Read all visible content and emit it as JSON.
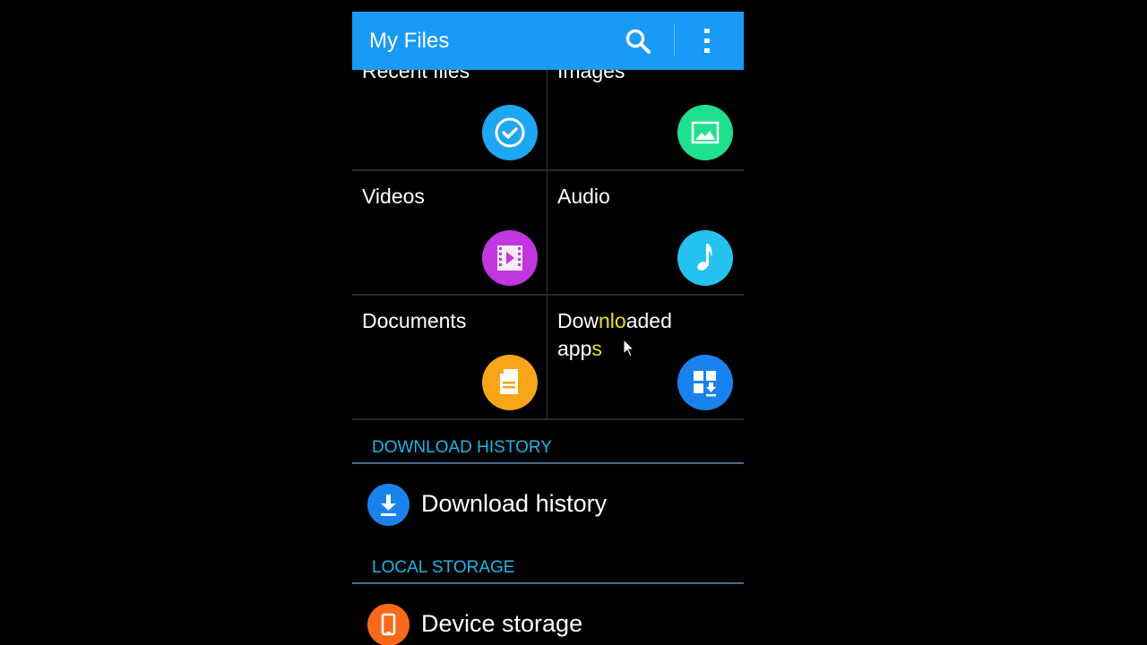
{
  "app": {
    "title": "My Files",
    "actions": {
      "search_icon": "search-icon",
      "more_icon": "more-vert-icon"
    },
    "accent_color": "#1a9af7"
  },
  "categories": [
    {
      "label": "Recent files",
      "icon": "clock-check-icon",
      "color": "#1ea7f2"
    },
    {
      "label": "Images",
      "icon": "image-icon",
      "color": "#1fe08e"
    },
    {
      "label": "Videos",
      "icon": "film-play-icon",
      "color": "#c236e0"
    },
    {
      "label": "Audio",
      "icon": "music-note-icon",
      "color": "#25c2f0"
    },
    {
      "label": "Documents",
      "icon": "document-icon",
      "color": "#f8a51a"
    },
    {
      "label_parts": [
        "Dow",
        "nlo",
        "aded",
        "app",
        "s"
      ],
      "label": "Downloaded apps",
      "icon": "apps-download-icon",
      "color": "#1a82ef"
    }
  ],
  "sections": [
    {
      "header": "DOWNLOAD HISTORY",
      "items": [
        {
          "label": "Download history",
          "icon": "download-icon",
          "color": "#1a82ef"
        }
      ]
    },
    {
      "header": "LOCAL STORAGE",
      "items": [
        {
          "label": "Device storage",
          "icon": "phone-icon",
          "color": "#f86a1a"
        }
      ]
    }
  ],
  "section_color": "#1fb3e8"
}
